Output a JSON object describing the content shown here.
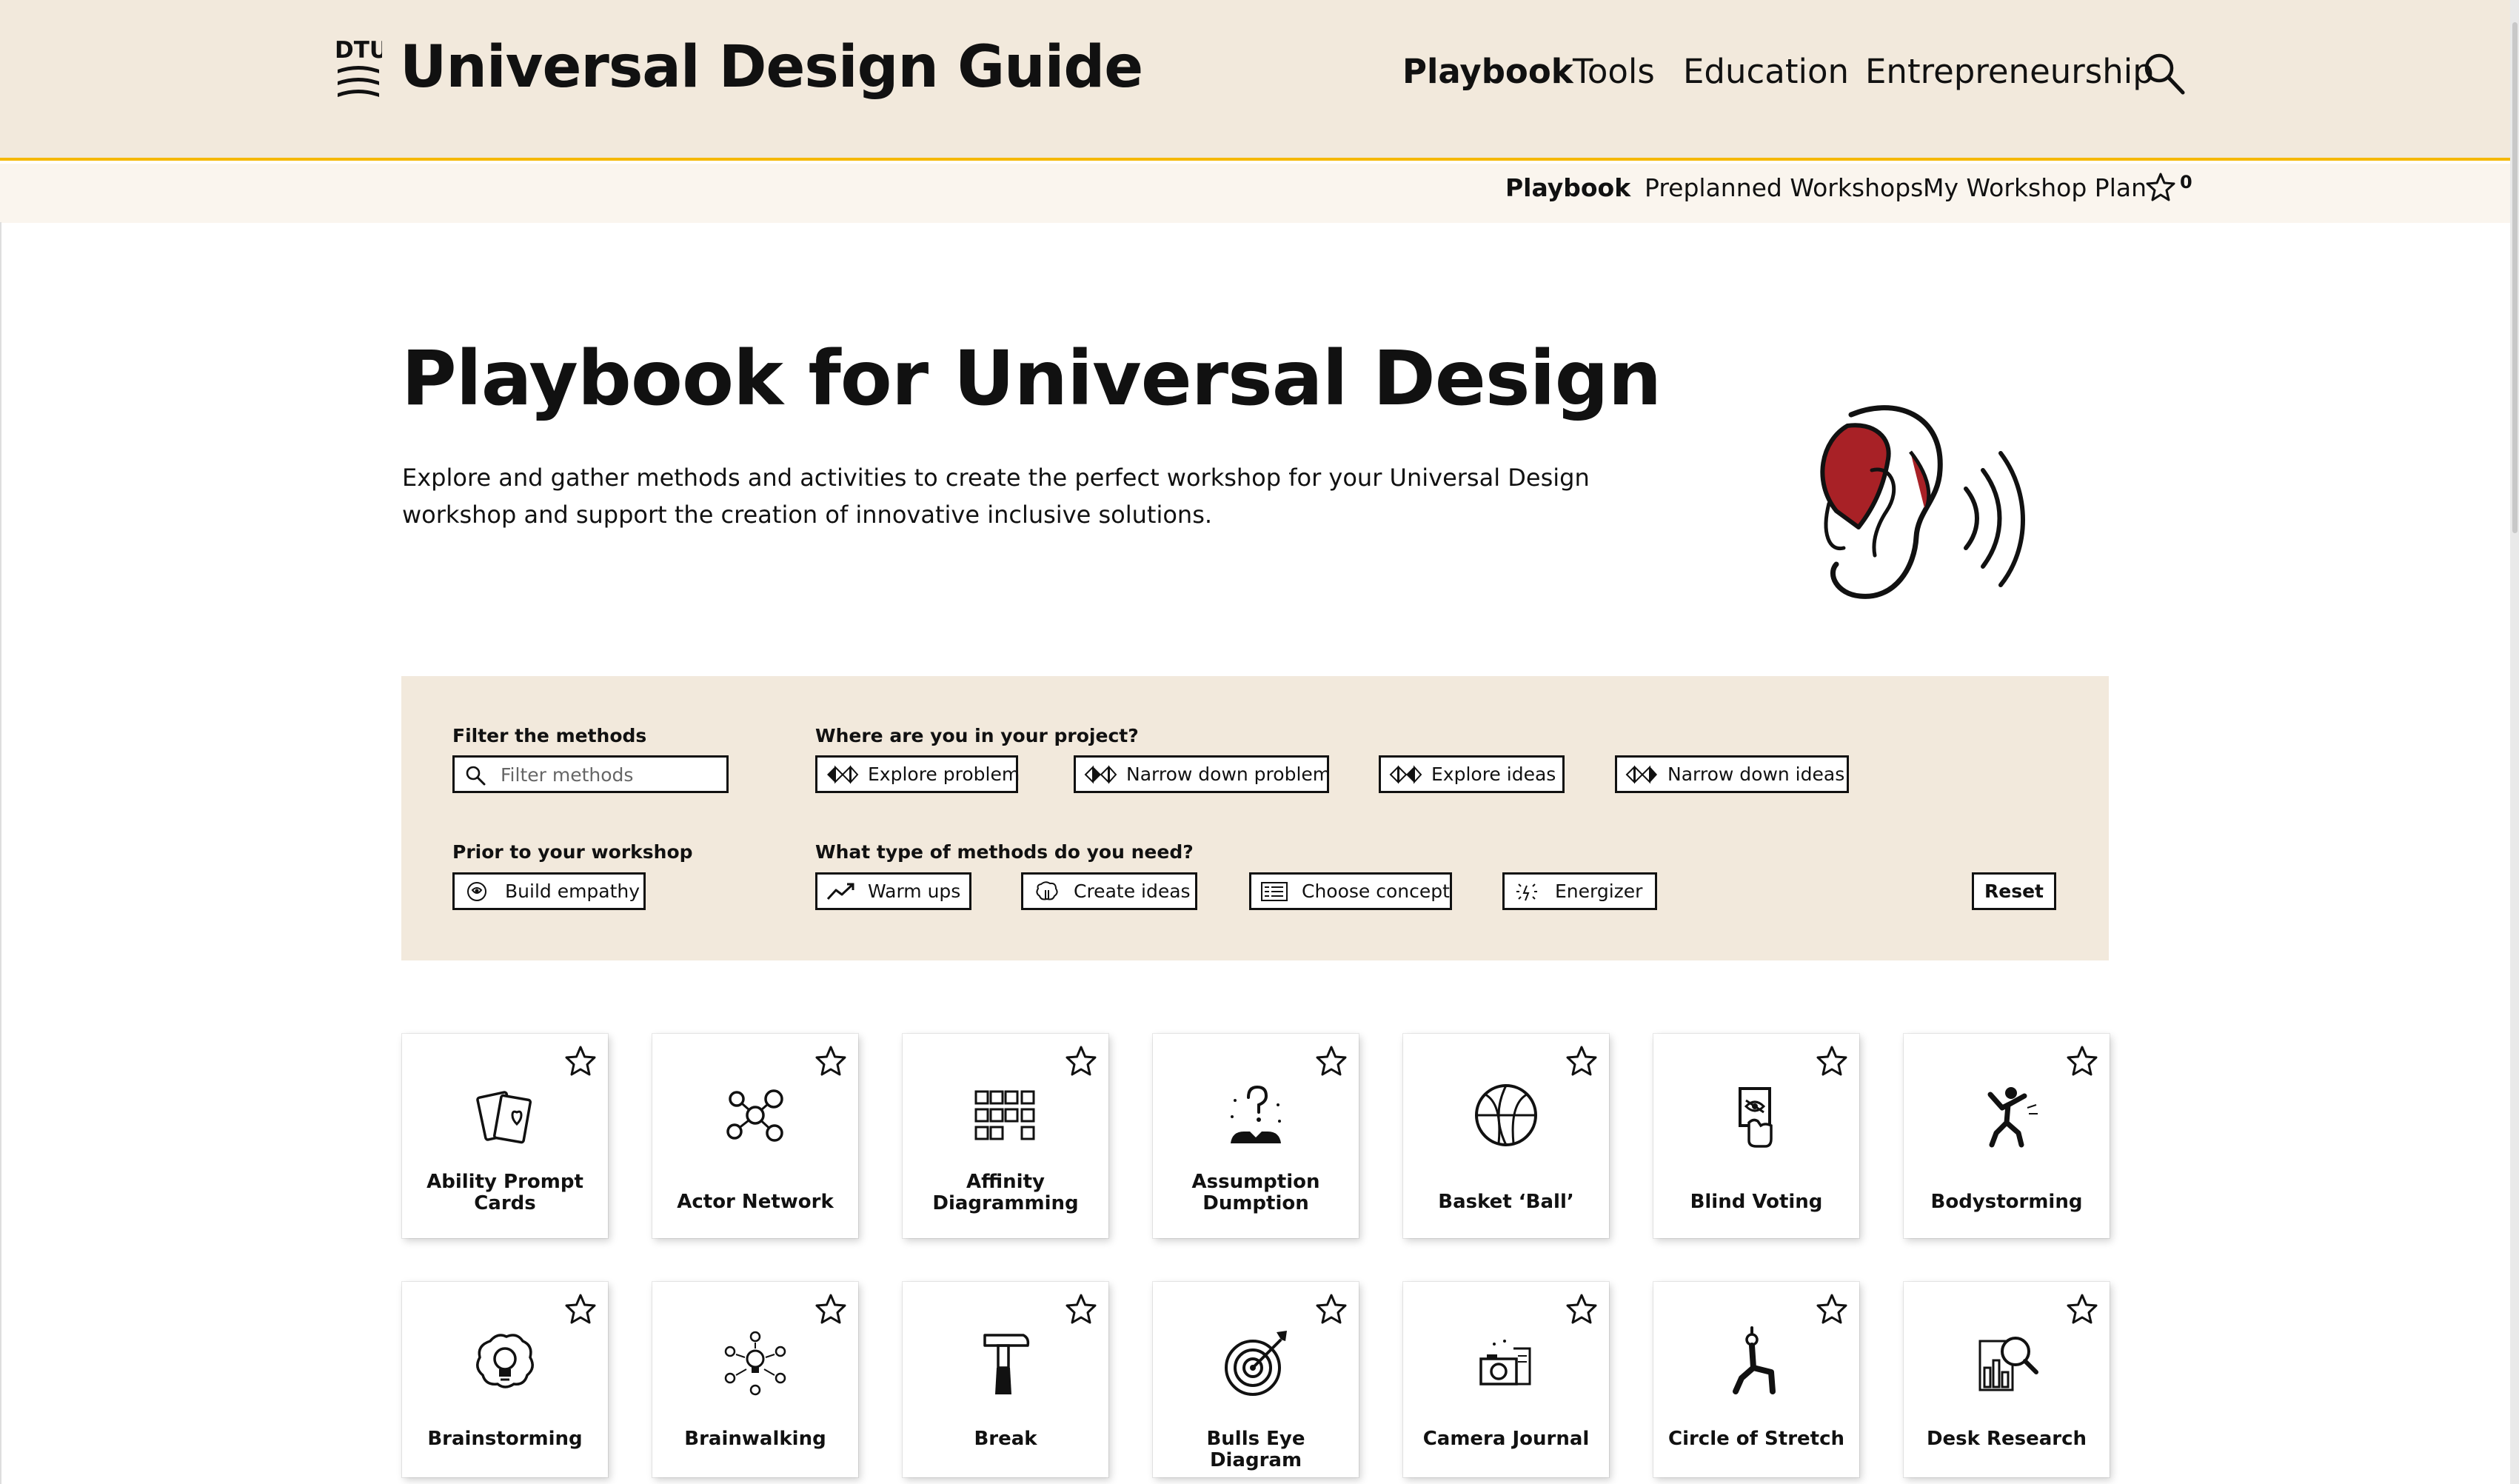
{
  "header": {
    "logo_text": "DTU",
    "site_title": "Universal Design Guide",
    "nav": [
      {
        "label": "Playbook",
        "active": true
      },
      {
        "label": "Tools",
        "active": false
      },
      {
        "label": "Education",
        "active": false
      },
      {
        "label": "Entrepreneurship",
        "active": false
      }
    ],
    "search_icon": "search-icon"
  },
  "subnav": {
    "items": [
      {
        "label": "Playbook",
        "active": true
      },
      {
        "label": "Preplanned Workshops",
        "active": false
      },
      {
        "label": "My Workshop Plan",
        "active": false
      }
    ],
    "favorites_count": "0"
  },
  "hero": {
    "title": "Playbook for Universal Design",
    "intro": "Explore and gather methods and activities to create the perfect workshop for your Universal Design workshop and support the creation of innovative inclusive solutions.",
    "illustration": "ear-icon"
  },
  "filters": {
    "filter_label": "Filter the methods",
    "search_placeholder": "Filter methods",
    "search_value": "",
    "stage_label": "Where are you in your project?",
    "stages": [
      {
        "label": "Explore problem",
        "icon": "explore-problem-icon"
      },
      {
        "label": "Narrow down problem",
        "icon": "narrow-problem-icon"
      },
      {
        "label": "Explore ideas",
        "icon": "explore-ideas-icon"
      },
      {
        "label": "Narrow down ideas",
        "icon": "narrow-ideas-icon"
      }
    ],
    "prior_label": "Prior to your workshop",
    "prior": [
      {
        "label": "Build empathy",
        "icon": "empathy-icon"
      }
    ],
    "type_label": "What type of methods do you need?",
    "types": [
      {
        "label": "Warm ups",
        "icon": "trend-icon"
      },
      {
        "label": "Create ideas",
        "icon": "brain-icon"
      },
      {
        "label": "Choose concept",
        "icon": "checklist-icon"
      },
      {
        "label": "Energizer",
        "icon": "spark-icon"
      }
    ],
    "reset_label": "Reset"
  },
  "methods": [
    {
      "name": "Ability Prompt Cards",
      "icon": "cards-icon"
    },
    {
      "name": "Actor Network",
      "icon": "network-icon"
    },
    {
      "name": "Affinity Diagramming",
      "icon": "sticky-notes-icon"
    },
    {
      "name": "Assumption Dumption",
      "icon": "question-icon"
    },
    {
      "name": "Basket ‘Ball’",
      "icon": "basketball-icon"
    },
    {
      "name": "Blind Voting",
      "icon": "voting-icon"
    },
    {
      "name": "Bodystorming",
      "icon": "running-figure-icon"
    },
    {
      "name": "Brainstorming",
      "icon": "lightbulb-brain-icon"
    },
    {
      "name": "Brainwalking",
      "icon": "idea-people-icon"
    },
    {
      "name": "Break",
      "icon": "hammer-icon"
    },
    {
      "name": "Bulls Eye Diagram",
      "icon": "target-icon"
    },
    {
      "name": "Camera Journal",
      "icon": "camera-icon"
    },
    {
      "name": "Circle of Stretch",
      "icon": "stretch-figure-icon"
    },
    {
      "name": "Desk Research",
      "icon": "magnifier-chart-icon"
    }
  ]
}
